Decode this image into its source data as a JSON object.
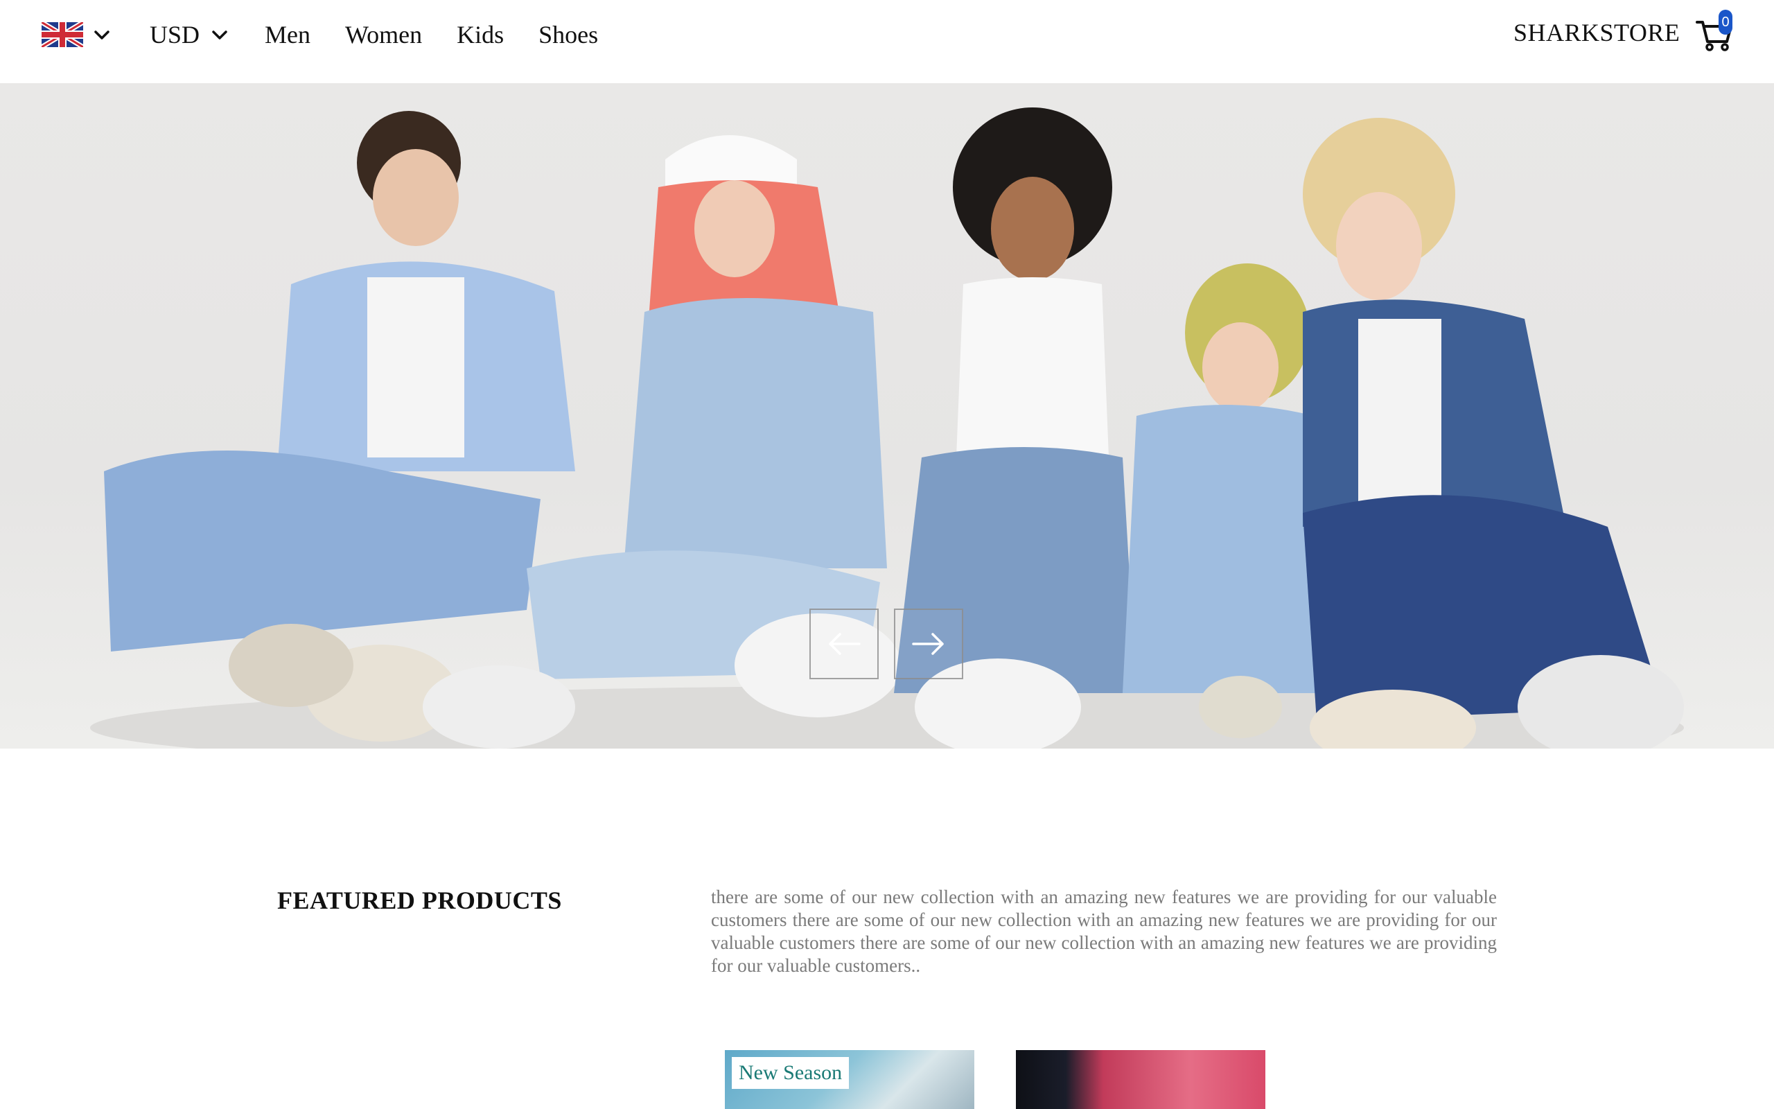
{
  "navbar": {
    "language_icon": "uk-flag-icon",
    "currency": "USD",
    "links": [
      "Men",
      "Women",
      "Kids",
      "Shoes"
    ],
    "brand": "SHARKSTORE",
    "cart_icon": "cart-icon",
    "cart_count": "0"
  },
  "hero": {
    "prev_icon": "arrow-left-icon",
    "next_icon": "arrow-right-icon"
  },
  "featured": {
    "title": "FEATURED PRODUCTS",
    "description": "there are some of our new collection with an amazing new features we are providing for our valuable customers there are some of our new collection with an amazing new features we are providing for our valuable customers there are some of our new collection with an amazing new features we are providing for our valuable customers.."
  },
  "products": [
    {
      "badge": "New Season"
    },
    {
      "badge": ""
    }
  ],
  "colors": {
    "accent_badge": "#1a56c9",
    "badge_text": "#1a7a75",
    "description_text": "#7a7a7a"
  }
}
